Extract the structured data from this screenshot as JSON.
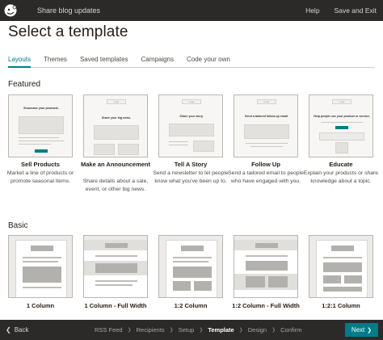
{
  "topbar": {
    "title": "Share blog updates",
    "help": "Help",
    "save_exit": "Save and Exit"
  },
  "page_title": "Select a template",
  "tabs": [
    {
      "label": "Layouts",
      "active": true
    },
    {
      "label": "Themes"
    },
    {
      "label": "Saved templates"
    },
    {
      "label": "Campaigns"
    },
    {
      "label": "Code your own"
    }
  ],
  "featured": {
    "heading": "Featured",
    "cards": [
      {
        "label": "Sell Products",
        "desc": "Market a line of products or promote seasonal items.",
        "preview_head": "Showcase your products.",
        "preview_logo": ""
      },
      {
        "label": "Make an Announcement",
        "desc": "Share details about a sale, event, or other big news.",
        "preview_head": "Share your big news.",
        "preview_logo": "Logo"
      },
      {
        "label": "Tell A Story",
        "desc": "Send a newsletter to let people know what you've been up to.",
        "preview_head": "Share your story.",
        "preview_logo": "Logo"
      },
      {
        "label": "Follow Up",
        "desc": "Send a tailored email to people who have engaged with you.",
        "preview_head": "Send a tailored follow-up email.",
        "preview_logo": "Logo"
      },
      {
        "label": "Educate",
        "desc": "Explain your products or share knowledge about a topic.",
        "preview_head": "Help people use your product or service.",
        "preview_logo": "Logo"
      }
    ]
  },
  "basic": {
    "heading": "Basic",
    "cards": [
      {
        "label": "1 Column"
      },
      {
        "label": "1 Column - Full Width"
      },
      {
        "label": "1:2 Column"
      },
      {
        "label": "1:2 Column - Full Width"
      },
      {
        "label": "1:2:1 Column"
      }
    ]
  },
  "footer": {
    "back": "Back",
    "steps": [
      {
        "label": "RSS Feed"
      },
      {
        "label": "Recipients"
      },
      {
        "label": "Setup"
      },
      {
        "label": "Template",
        "current": true
      },
      {
        "label": "Design"
      },
      {
        "label": "Confirm"
      }
    ],
    "next": "Next"
  },
  "colors": {
    "accent": "#007c89",
    "topbar": "#2b2a28"
  }
}
